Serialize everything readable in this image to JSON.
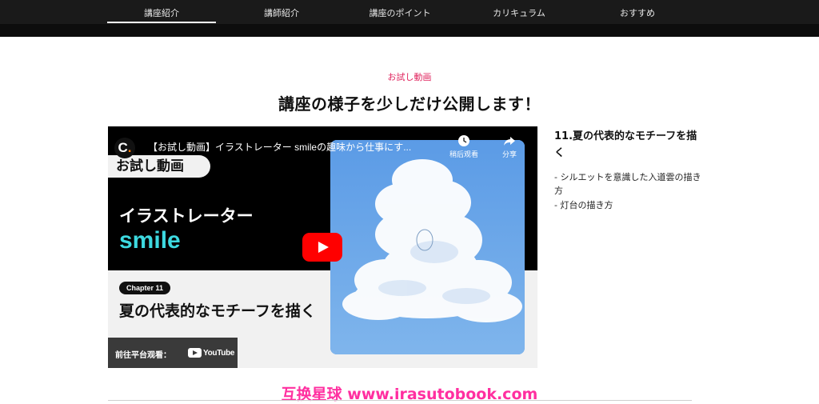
{
  "nav": {
    "items": [
      "講座紹介",
      "講師紹介",
      "講座のポイント",
      "カリキュラム",
      "おすすめ"
    ],
    "active_index": 0
  },
  "section": {
    "eyebrow": "お試し動画",
    "headline": "講座の様子を少しだけ公開します！"
  },
  "video": {
    "channel_logo": "C",
    "title": "【お試し動画】イラストレーター smileの趣味から仕事にす...",
    "watch_later_label": "稍后观看",
    "share_label": "分享",
    "thumbnail": {
      "pill": "お試し動画",
      "subtitle": "イラストレーター",
      "name": "smile",
      "chapter": "Chapter 11",
      "chapter_title": "夏の代表的なモチーフを描く"
    },
    "watch_on_label": "前往平台观看：",
    "platform": "YouTube",
    "play_icon": "play-icon",
    "accent_color": "#ff0000"
  },
  "sidebar": {
    "title": "11.夏の代表的なモチーフを描く",
    "items": [
      "- シルエットを意識した入道雲の描き方",
      "- 灯台の描き方"
    ]
  },
  "watermark": "互换星球 www.irasutobook.com"
}
